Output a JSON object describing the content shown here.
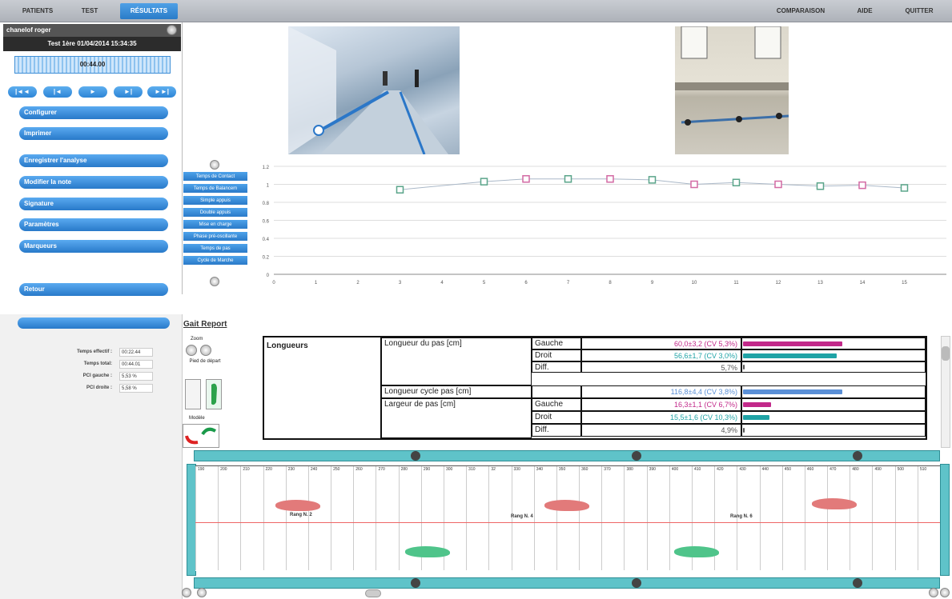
{
  "nav": {
    "left_tabs": [
      "PATIENTS",
      "TEST",
      "RÉSULTATS"
    ],
    "right_tabs": [
      "COMPARAISON",
      "AIDE",
      "QUITTER"
    ]
  },
  "sidebar": {
    "user": "chanelof roger",
    "test_line": "Test 1ère 01/04/2014 15:34:35",
    "time": "00:44.00",
    "playback": [
      "|◄◄",
      "|◄",
      "►",
      "►|",
      "►►|"
    ],
    "menu": [
      "Configurer",
      "Imprimer",
      "Enregistrer l'analyse",
      "Modifier la note",
      "Signature",
      "Paramètres",
      "Marqueurs",
      "Retour"
    ]
  },
  "chart_menu": [
    "Temps de Contact",
    "Temps de Balancem",
    "Simple appuis",
    "Double appuis",
    "Mise en charge",
    "Phase pré-oscillante",
    "Temps de pas",
    "Cycle de Marche"
  ],
  "chart_data": {
    "type": "scatter",
    "x_ticks": [
      0,
      1,
      2,
      3,
      4,
      5,
      6,
      7,
      8,
      9,
      10,
      11,
      12,
      13,
      14,
      15
    ],
    "y_ticks": [
      "0",
      "0.2",
      "0.4",
      "0.6",
      "0.8",
      "1",
      "1.2"
    ],
    "ylim": [
      0,
      1.2
    ],
    "series": [
      {
        "color": "#5aa58a",
        "x": [
          3,
          5,
          7,
          9,
          11,
          13,
          15
        ],
        "y": [
          0.94,
          1.03,
          1.06,
          1.05,
          1.02,
          0.98,
          0.96
        ]
      },
      {
        "color": "#d36aa4",
        "x": [
          6,
          8,
          10,
          12,
          14
        ],
        "y": [
          1.06,
          1.06,
          1.0,
          1.0,
          0.99
        ]
      }
    ]
  },
  "stats": {
    "rows": [
      {
        "label": "Temps effectif :",
        "value": "00:22.44"
      },
      {
        "label": "Temps total:",
        "value": "00:44.01"
      },
      {
        "label": "PCI gauche :",
        "value": "5,53 %"
      },
      {
        "label": "PCI droite :",
        "value": "5,58 %"
      }
    ]
  },
  "report": {
    "title": "Gait Report",
    "zoom": "Zoom",
    "pied": "Pied de départ",
    "modele": "Modèle",
    "section": "Longueurs",
    "params": [
      "Longueur du pas [cm]",
      "Longueur cycle pas [cm]",
      "Largeur de pas [cm]"
    ],
    "sides": [
      "Gauche",
      "Droit",
      "Diff.",
      "",
      "Gauche",
      "Droit",
      "Diff."
    ],
    "values": [
      "60,0±3,2 (CV 5,3%)",
      "56,6±1,7 (CV 3,0%)",
      "5,7%",
      "116,8±4,4 (CV 3,8%)",
      "16,3±1,1 (CV 6,7%)",
      "15,5±1,6 (CV 10,3%)",
      "4,9%"
    ],
    "value_colors": [
      "#c2298a",
      "#1fa3a6",
      "#555555",
      "#5a8fd6",
      "#c2298a",
      "#1fa3a6",
      "#555555"
    ],
    "bar_fractions": [
      0.95,
      0.9,
      0.0,
      0.95,
      0.27,
      0.25,
      0.0
    ]
  },
  "walkway": {
    "ticks": [
      "190",
      "200",
      "210",
      "220",
      "230",
      "240",
      "250",
      "260",
      "270",
      "280",
      "290",
      "300",
      "310",
      "32",
      "330",
      "340",
      "350",
      "360",
      "370",
      "380",
      "390",
      "400",
      "410",
      "420",
      "430",
      "440",
      "450",
      "460",
      "470",
      "480",
      "490",
      "500",
      "510"
    ],
    "labels": [
      "Rang N. 2",
      "Rang N. 4",
      "Rang N. 6"
    ]
  }
}
